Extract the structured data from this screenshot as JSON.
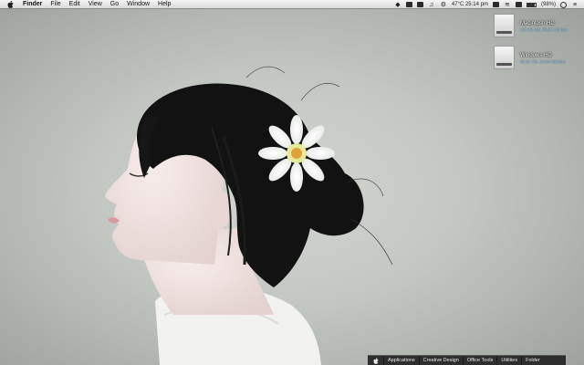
{
  "menubar": {
    "app_name": "Finder",
    "menus": [
      "File",
      "Edit",
      "View",
      "Go",
      "Window",
      "Help"
    ],
    "status": {
      "temperature_time": "47°C 25:14 pm",
      "battery": "(98%)",
      "icons": [
        "apple-icon",
        "dropbox-icon",
        "messages-icon",
        "screen-icon",
        "music-icon",
        "gears-icon",
        "notification-icon",
        "wifi-icon",
        "volume-icon",
        "battery-icon",
        "spotlight-icon",
        "list-icon"
      ]
    }
  },
  "desktop": {
    "drives": [
      {
        "name": "Macintosh HD",
        "info": "137.68 GB, 36.96 GB free"
      },
      {
        "name": "Windows HD",
        "info": "52.51 GB, 24.64 GB free"
      }
    ]
  },
  "dock": {
    "items": [
      "Applications",
      "Creative Design",
      "Office Tools",
      "Utilities",
      "Folder"
    ]
  }
}
